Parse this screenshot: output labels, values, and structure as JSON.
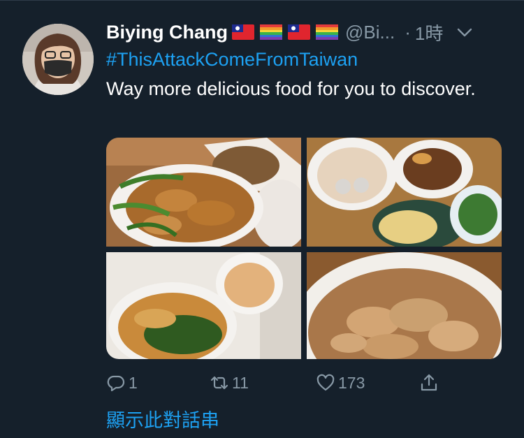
{
  "tweet": {
    "author_name": "Biying Chang",
    "flags": [
      "taiwan-flag",
      "rainbow-flag",
      "taiwan-flag",
      "rainbow-flag"
    ],
    "handle": "@Bi...",
    "separator": "·",
    "time": "1時",
    "hashtag": "#ThisAttackComeFromTaiwan",
    "text": "Way more delicious food for you to discover.",
    "media": [
      {
        "name": "fried-chicken-photo"
      },
      {
        "name": "soup-and-dishes-photo"
      },
      {
        "name": "noodle-soup-photo"
      },
      {
        "name": "wonton-soup-photo"
      }
    ],
    "actions": {
      "reply_count": "1",
      "retweet_count": "11",
      "like_count": "173"
    },
    "show_thread": "顯示此對話串"
  },
  "colors": {
    "background": "#15202b",
    "accent": "#1da1f2",
    "muted": "#8899a6",
    "text": "#ffffff"
  },
  "icons": [
    "avatar",
    "chevron-down-icon",
    "reply-icon",
    "retweet-icon",
    "like-icon",
    "share-icon"
  ]
}
